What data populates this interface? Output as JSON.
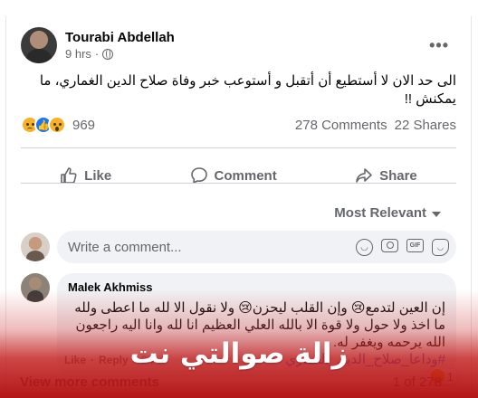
{
  "post": {
    "author": "Tourabi Abdellah",
    "time": "9 hrs",
    "separator": "·",
    "text": "الى حد الان لا أستطيع أن أتقبل و أستوعب خبر وفاة صلاح الدين الغماري، ما يمكنش !!",
    "reactions": [
      "sad",
      "like",
      "wow"
    ],
    "reaction_count": "969",
    "comments_count": "278 Comments",
    "shares_count": "22 Shares"
  },
  "actions": {
    "like": "Like",
    "comment": "Comment",
    "share": "Share"
  },
  "sort": {
    "label": "Most Relevant"
  },
  "composer": {
    "placeholder": "Write a comment...",
    "icons": [
      "emoji-icon",
      "camera-icon",
      "gif-icon",
      "sticker-icon"
    ],
    "gif_label": "GIF"
  },
  "comment": {
    "author": "Malek Akhmiss",
    "text": "إن العين لتدمع😢 وإن القلب ليحزن😢 ولا نقول الا لله ما اعطى ولله ما اخذ ولا حول ولا قوة الا بالله العلي العظيم انا لله وانا اليه راجعون الله يرحمه ويغفر له.",
    "hashtag": "#وداعا_صلاح_الدين_الغماري",
    "reaction_count": "1",
    "like": "Like",
    "reply": "Reply",
    "time": "2h",
    "dot": "·"
  },
  "footer": {
    "view_more": "View more comments",
    "paging": "1 of 278"
  },
  "watermark": "زالة صوالتي نت",
  "colors": {
    "accent": "#1877f2",
    "muted": "#65676b",
    "watermark_bg": "#b00a0a"
  }
}
